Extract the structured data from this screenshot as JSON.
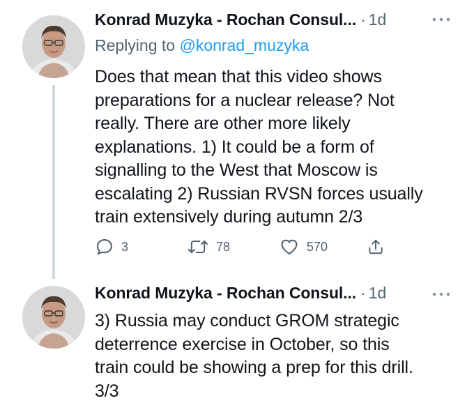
{
  "tweets": [
    {
      "author_name": "Konrad Muzyka - Rochan Consul...",
      "separator": "·",
      "time": "1d",
      "replying_prefix": "Replying to",
      "replying_handle": "@konrad_muzyka",
      "text_lines": [
        "Does that mean that this video shows",
        "preparations for a nuclear release? Not",
        "really. There are other more likely",
        "explanations. 1) It could be a form of",
        "signalling to the West that Moscow is",
        "escalating 2) Russian RVSN forces usually",
        "train extensively during autumn 2/3"
      ],
      "actions": {
        "reply_count": "3",
        "retweet_count": "78",
        "like_count": "570"
      }
    },
    {
      "author_name": "Konrad Muzyka - Rochan Consul...",
      "separator": "·",
      "time": "1d",
      "text_lines": [
        "3) Russia may conduct GROM strategic",
        "deterrence exercise in October, so this",
        "train could be showing a prep for this drill.",
        "3/3"
      ]
    }
  ],
  "icons": {
    "reply": "reply-icon",
    "retweet": "retweet-icon",
    "like": "heart-icon",
    "share": "share-icon",
    "more": "more-options-icon"
  },
  "colors": {
    "text": "#0f1419",
    "secondary": "#536471",
    "link": "#1d9bf0",
    "thread_line": "#cfd9de"
  }
}
